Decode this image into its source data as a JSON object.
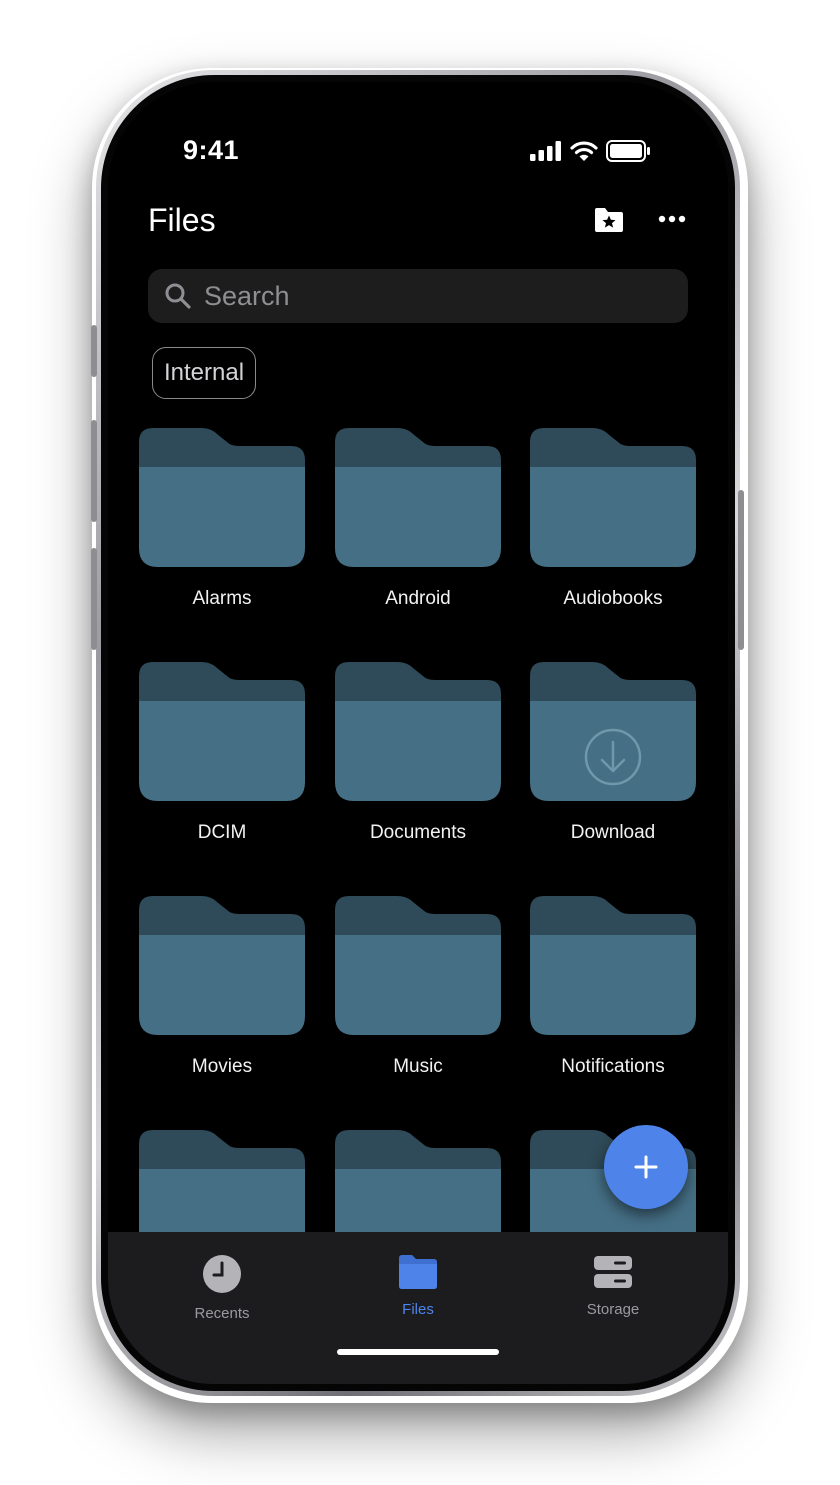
{
  "status_bar": {
    "time": "9:41"
  },
  "header": {
    "title": "Files",
    "favorite_folder_icon": "folder-star-icon",
    "more_icon": "more-horizontal-icon"
  },
  "search": {
    "placeholder": "Search",
    "icon": "search-icon"
  },
  "filter_chip": {
    "label": "Internal"
  },
  "folders": [
    {
      "label": "Alarms"
    },
    {
      "label": "Android"
    },
    {
      "label": "Audiobooks"
    },
    {
      "label": "DCIM"
    },
    {
      "label": "Documents"
    },
    {
      "label": "Download",
      "badge_icon": "download-icon"
    },
    {
      "label": "Movies"
    },
    {
      "label": "Music"
    },
    {
      "label": "Notifications"
    },
    {
      "label": ""
    },
    {
      "label": ""
    },
    {
      "label": ""
    }
  ],
  "fab": {
    "icon": "plus-icon"
  },
  "bottom_nav": {
    "items": [
      {
        "label": "Recents",
        "icon": "clock-icon",
        "active": false
      },
      {
        "label": "Files",
        "icon": "folder-icon",
        "active": true
      },
      {
        "label": "Storage",
        "icon": "storage-icon",
        "active": false
      }
    ]
  },
  "colors": {
    "accent": "#4e84ea",
    "folder_front": "#456f85",
    "folder_back": "#2f4a58",
    "background": "#000000",
    "nav_background": "#1c1c1e"
  }
}
